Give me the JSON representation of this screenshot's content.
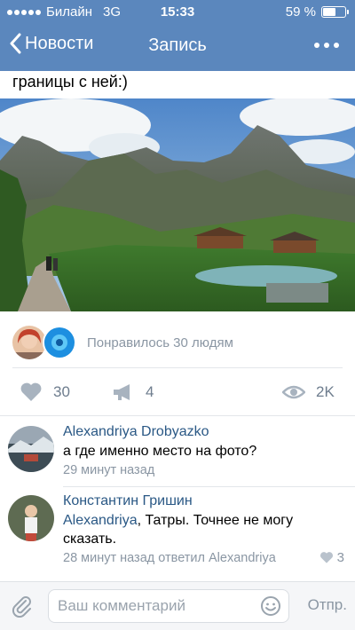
{
  "status": {
    "carrier": "Билайн",
    "network": "3G",
    "time": "15:33",
    "battery": "59 %",
    "battery_level": 0.59
  },
  "nav": {
    "back_label": "Новости",
    "title": "Запись"
  },
  "post": {
    "text": "границы с ней:)"
  },
  "likes": {
    "text": "Понравилось 30 людям"
  },
  "actions": {
    "likes_count": "30",
    "shares_count": "4",
    "views_count": "2K"
  },
  "comments": [
    {
      "author": "Alexandriya Drobyazko",
      "text": "а где именно место на фото?",
      "meta": "29 минут назад"
    },
    {
      "author": "Константин Гришин",
      "mention": "Alexandriya",
      "text_rest": ", Татры. Точнее не могу сказать.",
      "meta": "28 минут назад ответил Alexandriya",
      "likes": "3"
    }
  ],
  "composer": {
    "placeholder": "Ваш комментарий",
    "send_label": "Отпр."
  },
  "colors": {
    "header": "#5b87bd",
    "link": "#2a5885",
    "muted": "#8a96a3"
  },
  "icons": [
    "chevron-left-icon",
    "more-icon",
    "heart-icon",
    "megaphone-icon",
    "eye-icon",
    "paperclip-icon",
    "smile-icon"
  ]
}
